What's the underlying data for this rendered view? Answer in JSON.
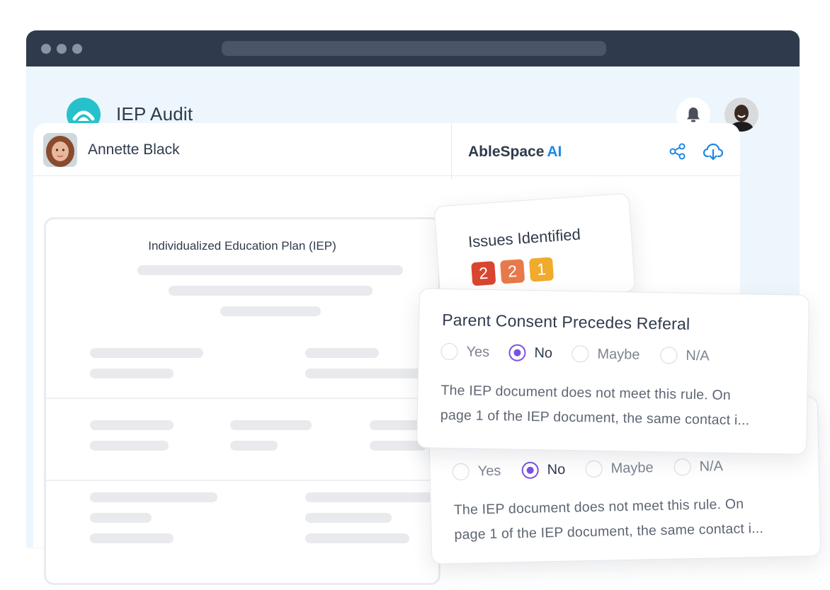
{
  "app": {
    "title": "IEP Audit"
  },
  "student": {
    "name": "Annette Black"
  },
  "ai_panel": {
    "brand": "AbleSpace",
    "brand_mark": "AI"
  },
  "document": {
    "title": "Individualized Education Plan (IEP)"
  },
  "issues": {
    "title": "Issues Identified",
    "badges": [
      {
        "count": "2",
        "color": "#d8462f"
      },
      {
        "count": "2",
        "color": "#e8794a"
      },
      {
        "count": "1",
        "color": "#f0aa2c"
      }
    ]
  },
  "rule_cards": [
    {
      "title": "Parent Consent Precedes Referal",
      "options": [
        "Yes",
        "No",
        "Maybe",
        "N/A"
      ],
      "selected": "No",
      "text_line1": "The IEP document does not meet this rule. On",
      "text_line2": "page 1 of the IEP document, the same contact i..."
    },
    {
      "options": [
        "Yes",
        "No",
        "Maybe",
        "N/A"
      ],
      "selected": "No",
      "text_line1": "The IEP document does not meet this rule. On",
      "text_line2": "page 1 of the IEP document, the same contact i..."
    }
  ],
  "colors": {
    "accent_teal": "#27c1cc",
    "accent_blue": "#1f87e5",
    "radio_purple": "#7a52e0",
    "chrome_dark": "#2f3b4c"
  },
  "icons": [
    "logo-icon",
    "bell-icon",
    "share-icon",
    "cloud-download-icon"
  ]
}
